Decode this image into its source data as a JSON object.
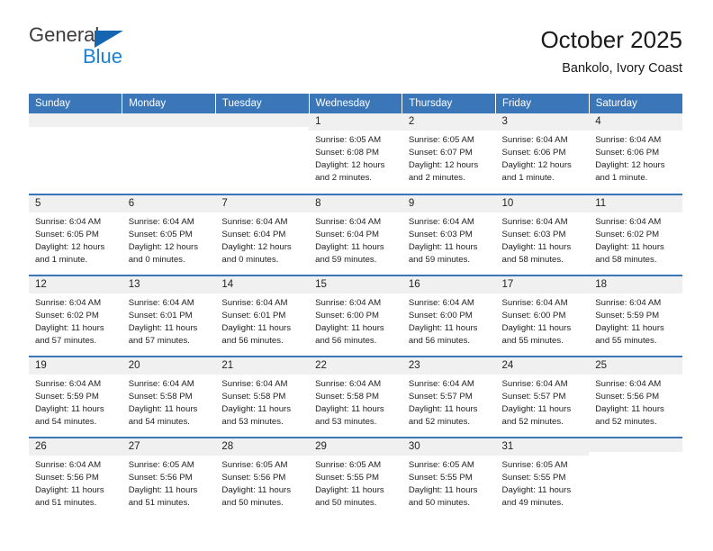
{
  "brand": {
    "name_top": "General",
    "name_bottom": "Blue",
    "triangle_icon": "blue-triangle-icon",
    "accent_color": "#1b7fd4"
  },
  "header": {
    "title": "October 2025",
    "subtitle": "Bankolo, Ivory Coast"
  },
  "theme": {
    "header_bg": "#3a76b8",
    "header_text": "#ffffff",
    "daynum_bg": "#f0f0f0",
    "row_border": "#3a76b8"
  },
  "calendar": {
    "weekday_headers": [
      "Sunday",
      "Monday",
      "Tuesday",
      "Wednesday",
      "Thursday",
      "Friday",
      "Saturday"
    ],
    "weeks": [
      [
        {
          "day": "",
          "empty": true
        },
        {
          "day": "",
          "empty": true
        },
        {
          "day": "",
          "empty": true
        },
        {
          "day": "1",
          "sunrise": "Sunrise: 6:05 AM",
          "sunset": "Sunset: 6:08 PM",
          "daylight_line1": "Daylight: 12 hours",
          "daylight_line2": "and 2 minutes."
        },
        {
          "day": "2",
          "sunrise": "Sunrise: 6:05 AM",
          "sunset": "Sunset: 6:07 PM",
          "daylight_line1": "Daylight: 12 hours",
          "daylight_line2": "and 2 minutes."
        },
        {
          "day": "3",
          "sunrise": "Sunrise: 6:04 AM",
          "sunset": "Sunset: 6:06 PM",
          "daylight_line1": "Daylight: 12 hours",
          "daylight_line2": "and 1 minute."
        },
        {
          "day": "4",
          "sunrise": "Sunrise: 6:04 AM",
          "sunset": "Sunset: 6:06 PM",
          "daylight_line1": "Daylight: 12 hours",
          "daylight_line2": "and 1 minute."
        }
      ],
      [
        {
          "day": "5",
          "sunrise": "Sunrise: 6:04 AM",
          "sunset": "Sunset: 6:05 PM",
          "daylight_line1": "Daylight: 12 hours",
          "daylight_line2": "and 1 minute."
        },
        {
          "day": "6",
          "sunrise": "Sunrise: 6:04 AM",
          "sunset": "Sunset: 6:05 PM",
          "daylight_line1": "Daylight: 12 hours",
          "daylight_line2": "and 0 minutes."
        },
        {
          "day": "7",
          "sunrise": "Sunrise: 6:04 AM",
          "sunset": "Sunset: 6:04 PM",
          "daylight_line1": "Daylight: 12 hours",
          "daylight_line2": "and 0 minutes."
        },
        {
          "day": "8",
          "sunrise": "Sunrise: 6:04 AM",
          "sunset": "Sunset: 6:04 PM",
          "daylight_line1": "Daylight: 11 hours",
          "daylight_line2": "and 59 minutes."
        },
        {
          "day": "9",
          "sunrise": "Sunrise: 6:04 AM",
          "sunset": "Sunset: 6:03 PM",
          "daylight_line1": "Daylight: 11 hours",
          "daylight_line2": "and 59 minutes."
        },
        {
          "day": "10",
          "sunrise": "Sunrise: 6:04 AM",
          "sunset": "Sunset: 6:03 PM",
          "daylight_line1": "Daylight: 11 hours",
          "daylight_line2": "and 58 minutes."
        },
        {
          "day": "11",
          "sunrise": "Sunrise: 6:04 AM",
          "sunset": "Sunset: 6:02 PM",
          "daylight_line1": "Daylight: 11 hours",
          "daylight_line2": "and 58 minutes."
        }
      ],
      [
        {
          "day": "12",
          "sunrise": "Sunrise: 6:04 AM",
          "sunset": "Sunset: 6:02 PM",
          "daylight_line1": "Daylight: 11 hours",
          "daylight_line2": "and 57 minutes."
        },
        {
          "day": "13",
          "sunrise": "Sunrise: 6:04 AM",
          "sunset": "Sunset: 6:01 PM",
          "daylight_line1": "Daylight: 11 hours",
          "daylight_line2": "and 57 minutes."
        },
        {
          "day": "14",
          "sunrise": "Sunrise: 6:04 AM",
          "sunset": "Sunset: 6:01 PM",
          "daylight_line1": "Daylight: 11 hours",
          "daylight_line2": "and 56 minutes."
        },
        {
          "day": "15",
          "sunrise": "Sunrise: 6:04 AM",
          "sunset": "Sunset: 6:00 PM",
          "daylight_line1": "Daylight: 11 hours",
          "daylight_line2": "and 56 minutes."
        },
        {
          "day": "16",
          "sunrise": "Sunrise: 6:04 AM",
          "sunset": "Sunset: 6:00 PM",
          "daylight_line1": "Daylight: 11 hours",
          "daylight_line2": "and 56 minutes."
        },
        {
          "day": "17",
          "sunrise": "Sunrise: 6:04 AM",
          "sunset": "Sunset: 6:00 PM",
          "daylight_line1": "Daylight: 11 hours",
          "daylight_line2": "and 55 minutes."
        },
        {
          "day": "18",
          "sunrise": "Sunrise: 6:04 AM",
          "sunset": "Sunset: 5:59 PM",
          "daylight_line1": "Daylight: 11 hours",
          "daylight_line2": "and 55 minutes."
        }
      ],
      [
        {
          "day": "19",
          "sunrise": "Sunrise: 6:04 AM",
          "sunset": "Sunset: 5:59 PM",
          "daylight_line1": "Daylight: 11 hours",
          "daylight_line2": "and 54 minutes."
        },
        {
          "day": "20",
          "sunrise": "Sunrise: 6:04 AM",
          "sunset": "Sunset: 5:58 PM",
          "daylight_line1": "Daylight: 11 hours",
          "daylight_line2": "and 54 minutes."
        },
        {
          "day": "21",
          "sunrise": "Sunrise: 6:04 AM",
          "sunset": "Sunset: 5:58 PM",
          "daylight_line1": "Daylight: 11 hours",
          "daylight_line2": "and 53 minutes."
        },
        {
          "day": "22",
          "sunrise": "Sunrise: 6:04 AM",
          "sunset": "Sunset: 5:58 PM",
          "daylight_line1": "Daylight: 11 hours",
          "daylight_line2": "and 53 minutes."
        },
        {
          "day": "23",
          "sunrise": "Sunrise: 6:04 AM",
          "sunset": "Sunset: 5:57 PM",
          "daylight_line1": "Daylight: 11 hours",
          "daylight_line2": "and 52 minutes."
        },
        {
          "day": "24",
          "sunrise": "Sunrise: 6:04 AM",
          "sunset": "Sunset: 5:57 PM",
          "daylight_line1": "Daylight: 11 hours",
          "daylight_line2": "and 52 minutes."
        },
        {
          "day": "25",
          "sunrise": "Sunrise: 6:04 AM",
          "sunset": "Sunset: 5:56 PM",
          "daylight_line1": "Daylight: 11 hours",
          "daylight_line2": "and 52 minutes."
        }
      ],
      [
        {
          "day": "26",
          "sunrise": "Sunrise: 6:04 AM",
          "sunset": "Sunset: 5:56 PM",
          "daylight_line1": "Daylight: 11 hours",
          "daylight_line2": "and 51 minutes."
        },
        {
          "day": "27",
          "sunrise": "Sunrise: 6:05 AM",
          "sunset": "Sunset: 5:56 PM",
          "daylight_line1": "Daylight: 11 hours",
          "daylight_line2": "and 51 minutes."
        },
        {
          "day": "28",
          "sunrise": "Sunrise: 6:05 AM",
          "sunset": "Sunset: 5:56 PM",
          "daylight_line1": "Daylight: 11 hours",
          "daylight_line2": "and 50 minutes."
        },
        {
          "day": "29",
          "sunrise": "Sunrise: 6:05 AM",
          "sunset": "Sunset: 5:55 PM",
          "daylight_line1": "Daylight: 11 hours",
          "daylight_line2": "and 50 minutes."
        },
        {
          "day": "30",
          "sunrise": "Sunrise: 6:05 AM",
          "sunset": "Sunset: 5:55 PM",
          "daylight_line1": "Daylight: 11 hours",
          "daylight_line2": "and 50 minutes."
        },
        {
          "day": "31",
          "sunrise": "Sunrise: 6:05 AM",
          "sunset": "Sunset: 5:55 PM",
          "daylight_line1": "Daylight: 11 hours",
          "daylight_line2": "and 49 minutes."
        },
        {
          "day": "",
          "empty": true
        }
      ]
    ]
  }
}
